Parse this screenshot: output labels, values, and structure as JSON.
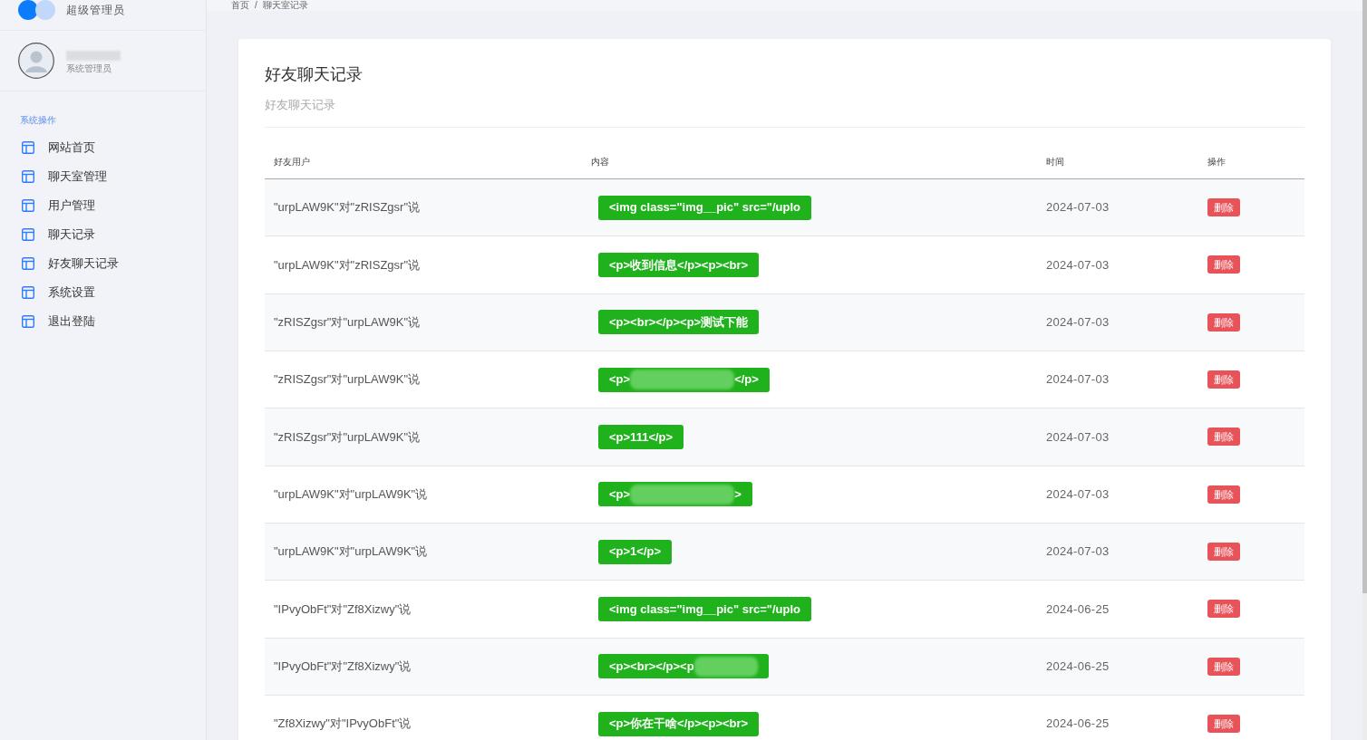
{
  "sidebar": {
    "brand": "超级管理员",
    "profile": {
      "role": "系统管理员"
    },
    "section_label": "系统操作",
    "items": [
      {
        "label": "网站首页",
        "selected": false
      },
      {
        "label": "聊天室管理",
        "selected": false
      },
      {
        "label": "用户管理",
        "selected": false
      },
      {
        "label": "聊天记录",
        "selected": false
      },
      {
        "label": "好友聊天记录",
        "selected": false
      },
      {
        "label": "系统设置",
        "selected": false
      },
      {
        "label": "退出登陆",
        "selected": false
      }
    ]
  },
  "breadcrumb": {
    "items": [
      "首页",
      "聊天室记录"
    ],
    "separator": "/"
  },
  "page": {
    "title": "好友聊天记录",
    "subtitle": "好友聊天记录"
  },
  "table": {
    "columns": [
      "好友用户",
      "内容",
      "时间",
      "操作"
    ],
    "rows": [
      {
        "user": "\"urpLAW9K\"对\"zRISZgsr\"说",
        "content": {
          "kind": "text",
          "text": "<img class=\"img__pic\" src=\"/uplo"
        },
        "time": "2024-07-03",
        "action": "删除"
      },
      {
        "user": "\"urpLAW9K\"对\"zRISZgsr\"说",
        "content": {
          "kind": "text",
          "text": "<p>收到信息</p><p><br>"
        },
        "time": "2024-07-03",
        "action": "删除"
      },
      {
        "user": "\"zRISZgsr\"对\"urpLAW9K\"说",
        "content": {
          "kind": "text",
          "text": "<p><br></p><p>测试下能"
        },
        "time": "2024-07-03",
        "action": "删除"
      },
      {
        "user": "\"zRISZgsr\"对\"urpLAW9K\"说",
        "content": {
          "kind": "redacted",
          "before": "<p>",
          "after": "</p>"
        },
        "time": "2024-07-03",
        "action": "删除"
      },
      {
        "user": "\"zRISZgsr\"对\"urpLAW9K\"说",
        "content": {
          "kind": "text",
          "text": "<p>111</p>"
        },
        "time": "2024-07-03",
        "action": "删除"
      },
      {
        "user": "\"urpLAW9K\"对\"urpLAW9K\"说",
        "content": {
          "kind": "redacted",
          "before": "<p>",
          "after": ">"
        },
        "time": "2024-07-03",
        "action": "删除"
      },
      {
        "user": "\"urpLAW9K\"对\"urpLAW9K\"说",
        "content": {
          "kind": "text",
          "text": "<p>1</p>"
        },
        "time": "2024-07-03",
        "action": "删除"
      },
      {
        "user": "\"IPvyObFt\"对\"Zf8Xizwy\"说",
        "content": {
          "kind": "text",
          "text": "<img class=\"img__pic\" src=\"/uplo"
        },
        "time": "2024-06-25",
        "action": "删除"
      },
      {
        "user": "\"IPvyObFt\"对\"Zf8Xizwy\"说",
        "content": {
          "kind": "redacted",
          "before": "<p><br></p><p"
        },
        "time": "2024-06-25",
        "action": "删除"
      },
      {
        "user": "\"Zf8Xizwy\"对\"IPvyObFt\"说",
        "content": {
          "kind": "text",
          "text": "<p>你在干啥</p><p><br>"
        },
        "time": "2024-06-25",
        "action": "删除"
      }
    ]
  }
}
